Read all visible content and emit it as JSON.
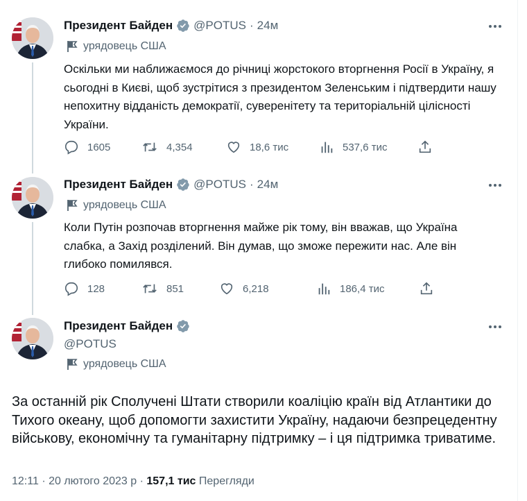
{
  "tweets": [
    {
      "name": "Президент Байден",
      "handle": "@POTUS",
      "separator": "·",
      "time": "24м",
      "label": "урядовець США",
      "text": "Оскільки ми наближаємося до річниці жорстокого вторгнення Росії в Україну, я сьогодні в Києві, щоб зустрітися з президентом Зеленським і підтвердити нашу непохитну відданість демократії, суверенітету та територіальній цілісності України.",
      "replies": "1605",
      "reposts": "4,354",
      "likes": "18,6 тис",
      "views": "537,6 тис"
    },
    {
      "name": "Президент Байден",
      "handle": "@POTUS",
      "separator": "·",
      "time": "24м",
      "label": "урядовець США",
      "text": "Коли Путін розпочав вторгнення майже рік тому, він вважав, що Україна слабка, а Захід розділений. Він думав, що зможе пережити нас. Але він глибоко помилявся.",
      "replies": "128",
      "reposts": "851",
      "likes": "6,218",
      "views": "186,4 тис"
    }
  ],
  "main": {
    "name": "Президент Байден",
    "handle": "@POTUS",
    "label": "урядовець США",
    "text": "За останній рік Сполучені Штати створили коаліцію країн від Атлантики до Тихого океану, щоб допомогти захистити Україну, надаючи безпрецедентну військову, економічну та гуманітарну підтримку – і ця підтримка триватиме.",
    "time": "12:11",
    "separator": "·",
    "date": "20 лютого 2023 р",
    "views_count": "157,1 тис",
    "views_label": "Перегляди"
  },
  "colors": {
    "verified": "#829aab",
    "secondary_text": "#536471",
    "thread_line": "#cfd9de"
  },
  "icons": [
    "verified-badge-icon",
    "more-icon",
    "flag-icon",
    "reply-icon",
    "repost-icon",
    "like-icon",
    "views-icon",
    "share-icon"
  ]
}
